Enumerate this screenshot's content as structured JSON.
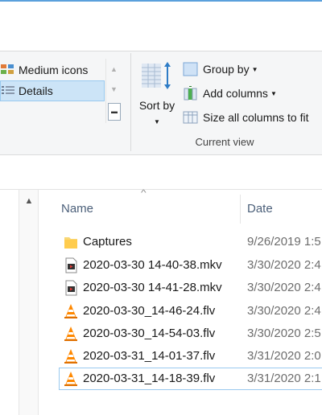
{
  "ribbon": {
    "layout": {
      "items": [
        {
          "label": "Medium icons",
          "icon": "medium-icons-icon"
        },
        {
          "label": "Details",
          "icon": "details-icon",
          "selected": true
        }
      ]
    },
    "current_view": {
      "sort_by_label": "Sort by",
      "group_by_label": "Group by",
      "add_columns_label": "Add columns",
      "size_columns_label": "Size all columns to fit",
      "group_label": "Current view"
    }
  },
  "file_list": {
    "columns": {
      "name": "Name",
      "date": "Date"
    },
    "files": [
      {
        "name": "Captures",
        "date": "9/26/2019 1:5",
        "icon": "folder-icon"
      },
      {
        "name": "2020-03-30 14-40-38.mkv",
        "date": "3/30/2020 2:4",
        "icon": "video-file-icon"
      },
      {
        "name": "2020-03-30 14-41-28.mkv",
        "date": "3/30/2020 2:4",
        "icon": "video-file-icon"
      },
      {
        "name": "2020-03-30_14-46-24.flv",
        "date": "3/30/2020 2:4",
        "icon": "vlc-cone-icon"
      },
      {
        "name": "2020-03-30_14-54-03.flv",
        "date": "3/30/2020 2:5",
        "icon": "vlc-cone-icon"
      },
      {
        "name": "2020-03-31_14-01-37.flv",
        "date": "3/31/2020 2:0",
        "icon": "vlc-cone-icon"
      },
      {
        "name": "2020-03-31_14-18-39.flv",
        "date": "3/31/2020 2:1",
        "icon": "vlc-cone-icon"
      }
    ]
  },
  "colors": {
    "accent": "#5aa0dc",
    "selection": "#cce4f7",
    "selection_border": "#99c9ef",
    "vlc_orange": "#ff8800"
  }
}
